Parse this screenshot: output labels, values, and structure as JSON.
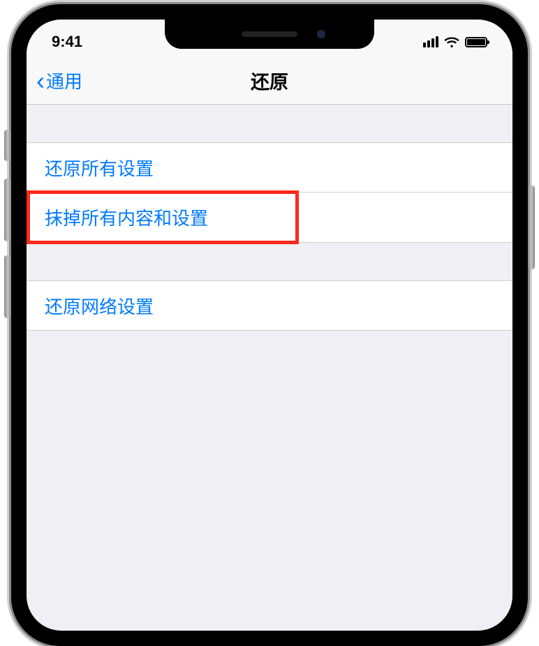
{
  "status": {
    "time": "9:41"
  },
  "nav": {
    "back_label": "通用",
    "title": "还原"
  },
  "items": {
    "reset_all": "还原所有设置",
    "erase_all": "抹掉所有内容和设置",
    "reset_network": "还原网络设置"
  }
}
